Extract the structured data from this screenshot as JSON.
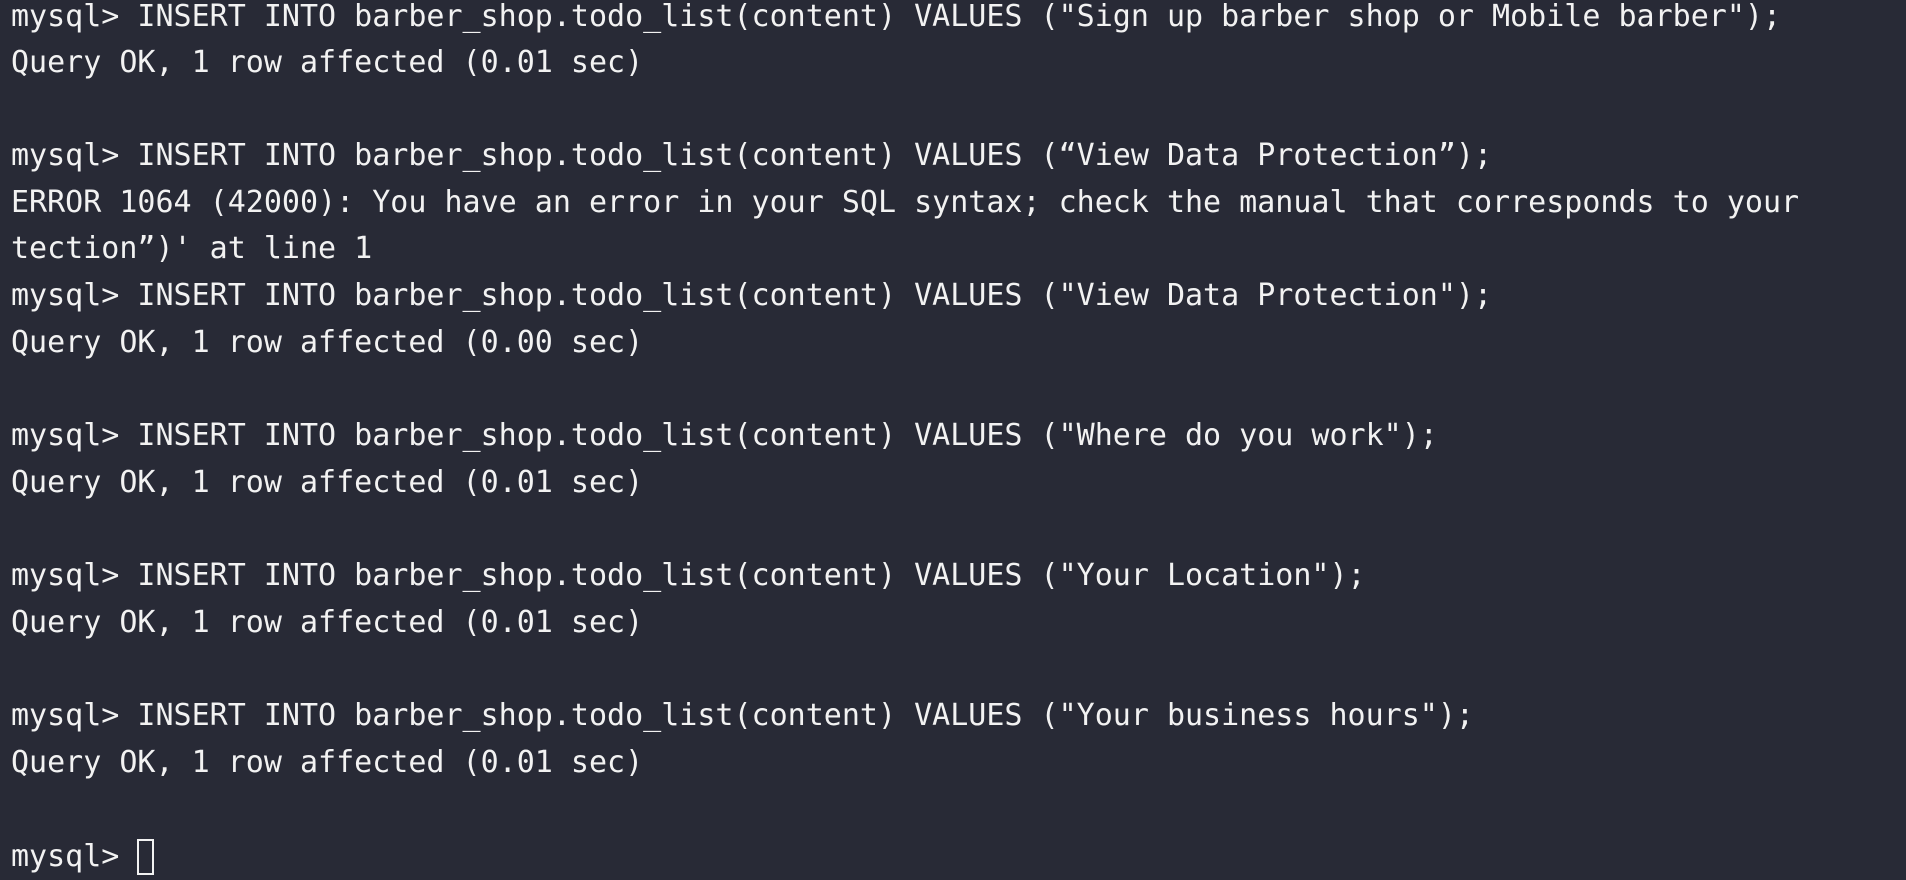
{
  "terminal": {
    "lines": [
      "mysql> INSERT INTO barber_shop.todo_list(content) VALUES (\"Sign up barber shop or Mobile barber\");",
      "Query OK, 1 row affected (0.01 sec)",
      "",
      "mysql> INSERT INTO barber_shop.todo_list(content) VALUES (“View Data Protection”);",
      "ERROR 1064 (42000): You have an error in your SQL syntax; check the manual that corresponds to your",
      "tection”)' at line 1",
      "mysql> INSERT INTO barber_shop.todo_list(content) VALUES (\"View Data Protection\");",
      "Query OK, 1 row affected (0.00 sec)",
      "",
      "mysql> INSERT INTO barber_shop.todo_list(content) VALUES (\"Where do you work\");",
      "Query OK, 1 row affected (0.01 sec)",
      "",
      "mysql> INSERT INTO barber_shop.todo_list(content) VALUES (\"Your Location\");",
      "Query OK, 1 row affected (0.01 sec)",
      "",
      "mysql> INSERT INTO barber_shop.todo_list(content) VALUES (\"Your business hours\");",
      "Query OK, 1 row affected (0.01 sec)",
      ""
    ],
    "prompt": "mysql> "
  }
}
